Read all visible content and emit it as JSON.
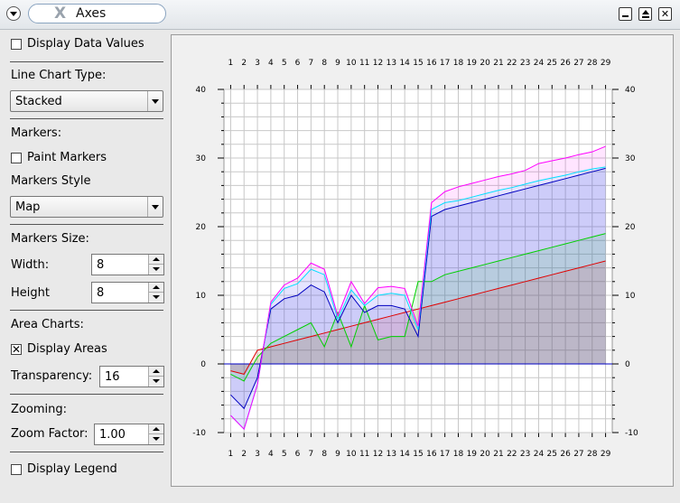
{
  "window": {
    "title": "Axes"
  },
  "panel": {
    "display_data_values": {
      "label": "Display Data Values",
      "checked": false
    },
    "line_chart_type": {
      "label": "Line Chart Type:",
      "value": "Stacked"
    },
    "markers": {
      "label": "Markers:"
    },
    "paint_markers": {
      "label": "Paint Markers",
      "checked": false
    },
    "markers_style": {
      "label": "Markers Style",
      "value": "Map"
    },
    "markers_size": {
      "label": "Markers Size:"
    },
    "width": {
      "label": "Width:",
      "value": "8"
    },
    "height": {
      "label": "Height",
      "value": "8"
    },
    "area_charts": {
      "label": "Area Charts:"
    },
    "display_areas": {
      "label": "Display Areas",
      "checked": true
    },
    "transparency": {
      "label": "Transparency:",
      "value": "16"
    },
    "zooming": {
      "label": "Zooming:"
    },
    "zoom_factor": {
      "label": "Zoom Factor:",
      "value": "1.00"
    },
    "display_legend": {
      "label": "Display Legend",
      "checked": false
    }
  },
  "chart_data": {
    "type": "area",
    "stacked": true,
    "x": [
      1,
      2,
      3,
      4,
      5,
      6,
      7,
      8,
      9,
      10,
      11,
      12,
      13,
      14,
      15,
      16,
      17,
      18,
      19,
      20,
      21,
      22,
      23,
      24,
      25,
      26,
      27,
      28,
      29
    ],
    "ylim": [
      -10,
      40
    ],
    "yticks": [
      -10,
      0,
      10,
      20,
      30,
      40
    ],
    "grid": true,
    "series": [
      {
        "color": "#e00000",
        "values": [
          -1,
          -1.5,
          2,
          2.5,
          3,
          3.5,
          4,
          4.5,
          5,
          5.5,
          6,
          6.5,
          7,
          7.5,
          8,
          8.5,
          9,
          9.5,
          10,
          10.5,
          11,
          11.5,
          12,
          12.5,
          13,
          13.5,
          14,
          14.5,
          15
        ]
      },
      {
        "color": "#00d000",
        "values": [
          -0.5,
          -1,
          -1,
          0.5,
          1,
          1.5,
          2,
          -2,
          2.5,
          -3,
          2.5,
          -3,
          -3,
          -3.5,
          4,
          3.5,
          4,
          4,
          4,
          4,
          4,
          4,
          4,
          4,
          4,
          4,
          4,
          4,
          4
        ]
      },
      {
        "color": "#0000c0",
        "values": [
          -3,
          -4,
          -3,
          5,
          5.5,
          5,
          5.5,
          8,
          -1.5,
          7.5,
          -1,
          5,
          4.5,
          4,
          -8,
          9.5,
          9.5,
          9.5,
          9.5,
          9.5,
          9.5,
          9.5,
          9.5,
          9.5,
          9.5,
          9.5,
          9.5,
          9.5,
          9.5
        ]
      },
      {
        "color": "#00e0ff",
        "values": [
          -3,
          -3,
          -1,
          0.7,
          1.5,
          1.7,
          2.3,
          2.5,
          0.5,
          0.8,
          1,
          1.5,
          1.8,
          2,
          1,
          1,
          1,
          0.8,
          0.8,
          0.8,
          0.8,
          0.7,
          0.7,
          0.7,
          0.6,
          0.5,
          0.5,
          0.4,
          0.2
        ]
      },
      {
        "color": "#ff00ff",
        "values": [
          0,
          0,
          0,
          0.3,
          0.5,
          0.8,
          0.9,
          0.8,
          0.5,
          1.2,
          0.3,
          1.1,
          1,
          1,
          0.5,
          1,
          1.6,
          2,
          2,
          2,
          2,
          2,
          2,
          2.5,
          2.5,
          2.5,
          2.5,
          2.5,
          3
        ]
      }
    ]
  }
}
